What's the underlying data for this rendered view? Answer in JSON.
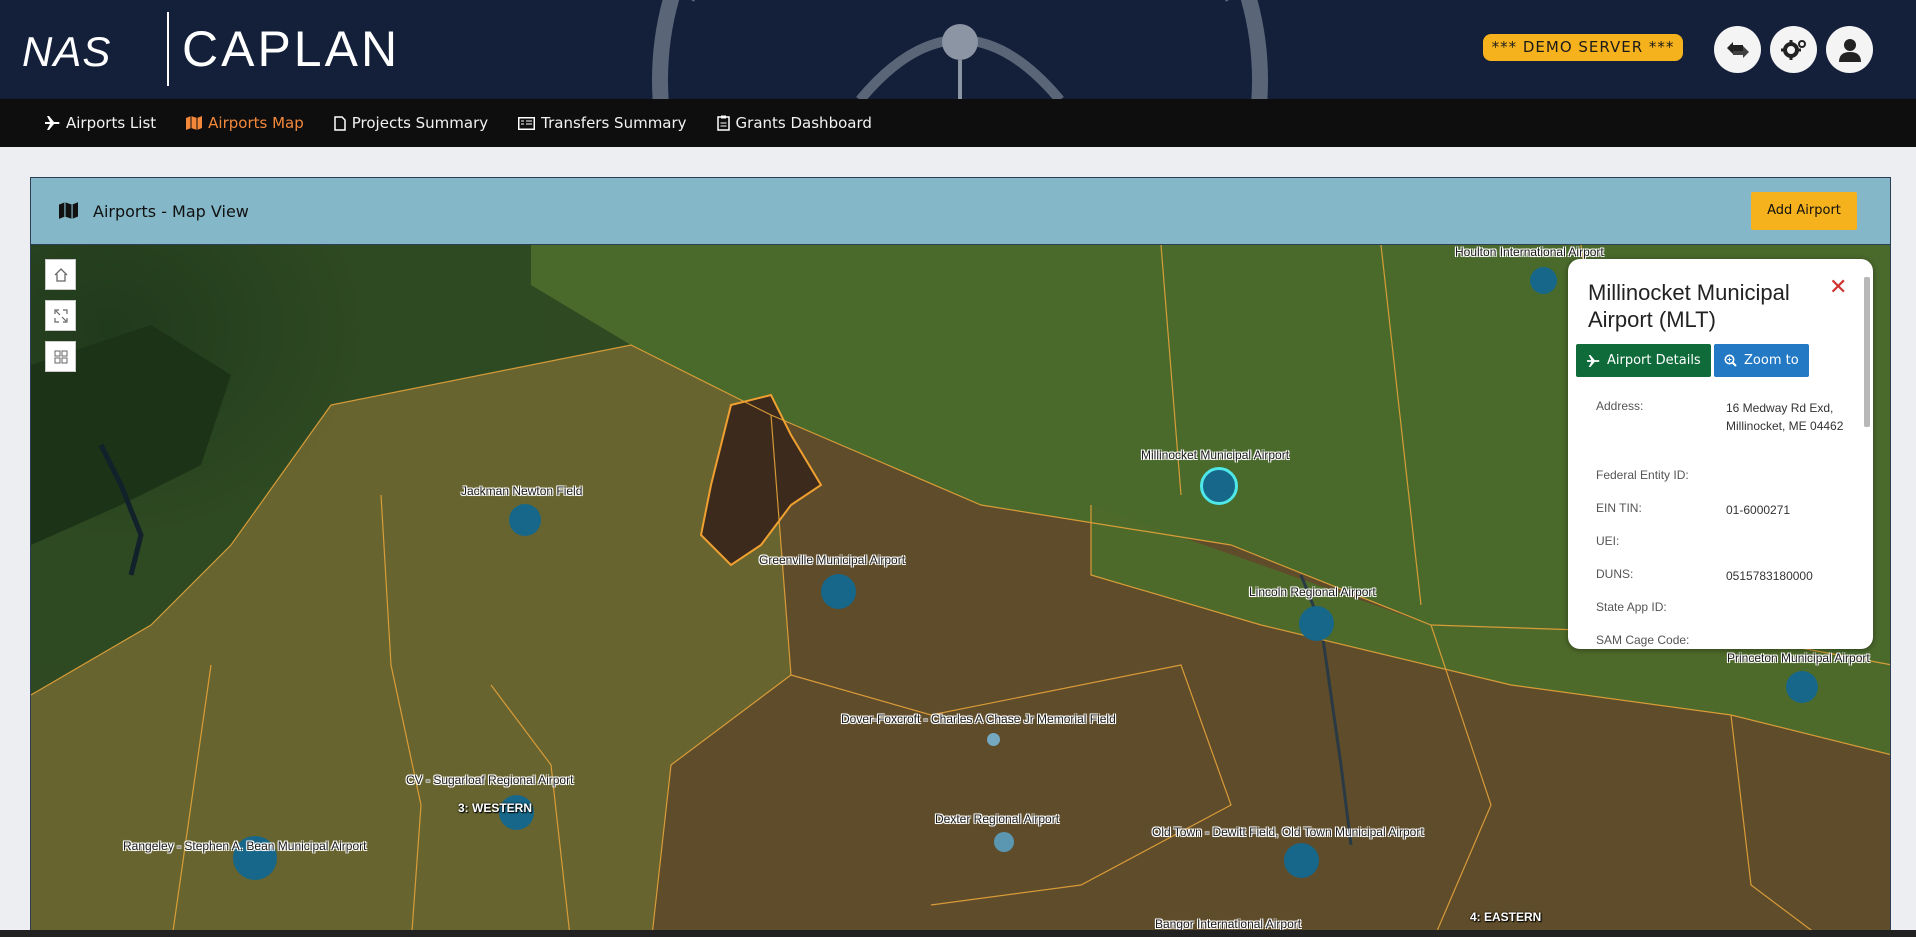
{
  "header": {
    "logo_left": "NAS",
    "logo_right": "CAPLAN",
    "demo_badge": "*** DEMO SERVER ***",
    "icons": [
      "transfer-icon",
      "settings-icon",
      "user-icon"
    ]
  },
  "nav": {
    "items": [
      {
        "label": "Airports List",
        "icon": "airplane-icon",
        "active": false
      },
      {
        "label": "Airports Map",
        "icon": "map-icon",
        "active": true
      },
      {
        "label": "Projects Summary",
        "icon": "document-icon",
        "active": false
      },
      {
        "label": "Transfers Summary",
        "icon": "list-card-icon",
        "active": false
      },
      {
        "label": "Grants Dashboard",
        "icon": "clipboard-icon",
        "active": false
      }
    ]
  },
  "panel": {
    "title": "Airports - Map View",
    "add_button": "Add Airport"
  },
  "map": {
    "tools": [
      "home-icon",
      "fullscreen-icon",
      "grid-icon"
    ],
    "airports": [
      "Houlton International Airport",
      "Millinocket Municipal Airport",
      "Jackman Newton Field",
      "Greenville Municipal Airport",
      "Lincoln Regional Airport",
      "Princeton Municipal Airport",
      "Dover-Foxcroft - Charles A Chase Jr Memorial Field",
      "CV - Sugarloaf Regional Airport",
      "Dexter Regional Airport",
      "Old Town - Dewitt Field, Old Town Municipal Airport",
      "Rangeley - Stephen A. Bean Municipal Airport",
      "Bangor International Airport"
    ],
    "regions": [
      "3: WESTERN",
      "4: EASTERN"
    ]
  },
  "popup": {
    "title": "Millinocket Municipal Airport (MLT)",
    "details_button": "Airport Details",
    "zoom_button": "Zoom to",
    "fields": [
      {
        "key": "Address:",
        "value": "16 Medway Rd Exd, Millinocket, ME 04462"
      },
      {
        "key": "Federal Entity ID:",
        "value": ""
      },
      {
        "key": "EIN TIN:",
        "value": "01-6000271"
      },
      {
        "key": "UEI:",
        "value": ""
      },
      {
        "key": "DUNS:",
        "value": "0515783180000"
      },
      {
        "key": "State App ID:",
        "value": ""
      },
      {
        "key": "SAM Cage Code:",
        "value": ""
      }
    ],
    "colors": {
      "details": "#0f6b3a",
      "zoom": "#2379c4",
      "close": "#d0322f"
    }
  }
}
